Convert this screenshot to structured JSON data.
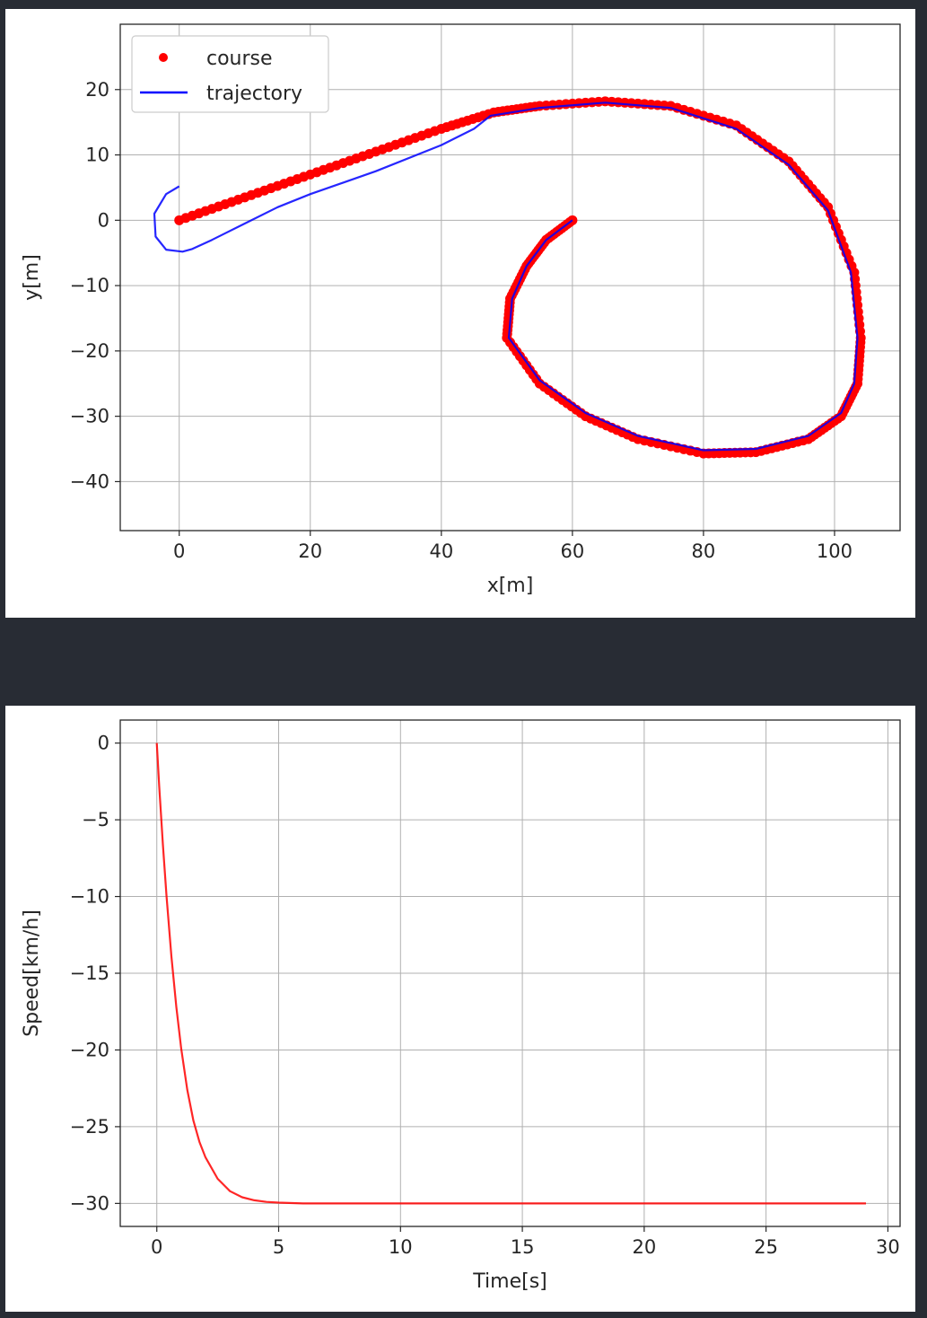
{
  "chart_data": [
    {
      "type": "line",
      "xlabel": "x[m]",
      "ylabel": "y[m]",
      "xlim": [
        -9,
        110
      ],
      "ylim": [
        -47.5,
        30
      ],
      "xticks": [
        0,
        20,
        40,
        60,
        80,
        100
      ],
      "yticks": [
        20,
        10,
        0,
        -10,
        -20,
        -30,
        -40
      ],
      "grid": true,
      "legend": {
        "placement": "top-left",
        "entries": [
          "course",
          "trajectory"
        ]
      },
      "series": [
        {
          "name": "course",
          "style": "points",
          "color": "#ff0000",
          "x": [
            0,
            10,
            20,
            30,
            40,
            48,
            55,
            65,
            75,
            85,
            93,
            99,
            103,
            104,
            103.5,
            101,
            96,
            88,
            80,
            70,
            62,
            55,
            50,
            50.5,
            53,
            56,
            60
          ],
          "y": [
            0,
            3.5,
            7,
            10.5,
            14,
            16.5,
            17.5,
            18.2,
            17.5,
            14.5,
            9,
            2,
            -8,
            -18,
            -25,
            -30,
            -33.5,
            -35.5,
            -35.7,
            -33.5,
            -30,
            -25,
            -18,
            -12,
            -7,
            -3,
            0
          ]
        },
        {
          "name": "trajectory",
          "style": "line",
          "color": "#0000ff",
          "x": [
            0,
            -2,
            -3.8,
            -3.6,
            -2,
            0.5,
            2,
            5,
            10,
            15,
            20,
            30,
            40,
            45,
            47.5,
            55,
            65,
            75,
            85,
            93,
            99,
            102.5,
            103.5,
            103,
            101,
            96,
            88,
            80,
            70,
            62,
            55,
            50.3,
            50.8,
            53,
            56,
            60
          ],
          "y": [
            5.2,
            4,
            1,
            -2.5,
            -4.5,
            -4.8,
            -4.4,
            -3,
            -0.5,
            2,
            4,
            7.5,
            11.5,
            14,
            16,
            17.2,
            18,
            17.2,
            14,
            8.5,
            1.5,
            -8,
            -18,
            -25,
            -29.5,
            -33,
            -35,
            -35.2,
            -33,
            -29.5,
            -24.5,
            -18,
            -12,
            -7,
            -3,
            0
          ]
        }
      ]
    },
    {
      "type": "line",
      "xlabel": "Time[s]",
      "ylabel": "Speed[km/h]",
      "xlim": [
        -1.5,
        30.5
      ],
      "ylim": [
        -31.5,
        1.5
      ],
      "xticks": [
        0,
        5,
        10,
        15,
        20,
        25,
        30
      ],
      "yticks": [
        0,
        -5,
        -10,
        -15,
        -20,
        -25,
        -30
      ],
      "grid": true,
      "series": [
        {
          "style": "line",
          "color": "#ff0000",
          "x": [
            0,
            0.1,
            0.25,
            0.4,
            0.6,
            0.8,
            1.0,
            1.25,
            1.5,
            1.75,
            2.0,
            2.5,
            3.0,
            3.5,
            4.0,
            4.5,
            5.0,
            6,
            7,
            8,
            10,
            15,
            20,
            25,
            29.1
          ],
          "y": [
            0,
            -2.8,
            -6.6,
            -10.0,
            -13.9,
            -17.2,
            -19.9,
            -22.6,
            -24.6,
            -26.0,
            -27.0,
            -28.4,
            -29.2,
            -29.6,
            -29.8,
            -29.9,
            -29.95,
            -30,
            -30,
            -30,
            -30,
            -30,
            -30,
            -30,
            -30
          ]
        }
      ]
    }
  ]
}
